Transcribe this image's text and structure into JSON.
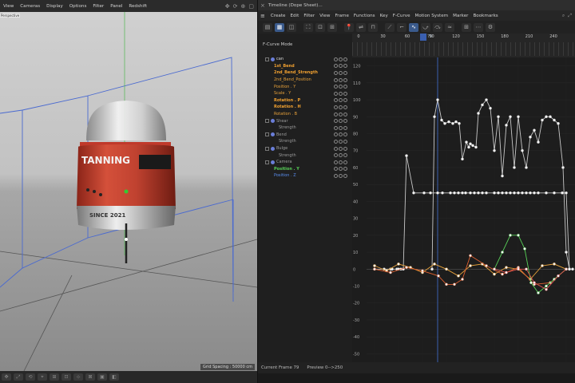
{
  "viewport": {
    "menu": [
      "View",
      "Cameras",
      "Display",
      "Options",
      "Filter",
      "Panel",
      "Redshift"
    ],
    "label": "Perspective",
    "grid_spacing": "Grid Spacing : 50000 cm",
    "can_text": {
      "brand": "TANNING",
      "sub": "SINCE 2021"
    }
  },
  "timeline": {
    "title": "Timeline (Dope Sheet)...",
    "menu": [
      "Create",
      "Edit",
      "Filter",
      "View",
      "Frame",
      "Functions",
      "Key",
      "F-Curve",
      "Motion System",
      "Marker",
      "Bookmarks"
    ],
    "mode_label": "F-Curve Mode",
    "ruler": {
      "ticks": [
        "0",
        "30",
        "60",
        "90",
        "120",
        "150",
        "180",
        "210",
        "240"
      ],
      "current": "79"
    },
    "tracks": [
      {
        "label": "can",
        "color": "white",
        "type": "object"
      },
      {
        "label": "1st_Bend",
        "color": "orange-bold"
      },
      {
        "label": "2nd_Bend_Strength",
        "color": "orange-bold"
      },
      {
        "label": "2nd_Bend_Position",
        "color": "orange"
      },
      {
        "label": "Position . Y",
        "color": "orange"
      },
      {
        "label": "Scale . Y",
        "color": "orange"
      },
      {
        "label": "Rotation . P",
        "color": "orange-bold"
      },
      {
        "label": "Rotation . H",
        "color": "orange-bold"
      },
      {
        "label": "Rotation . B",
        "color": "orange"
      },
      {
        "label": "Shear",
        "color": "gray",
        "type": "object"
      },
      {
        "label": "Strength",
        "color": "gray"
      },
      {
        "label": "Bend",
        "color": "gray",
        "type": "object"
      },
      {
        "label": "Strength",
        "color": "gray"
      },
      {
        "label": "Bulge",
        "color": "gray",
        "type": "object"
      },
      {
        "label": "Strength",
        "color": "gray"
      },
      {
        "label": "Camera",
        "color": "gray",
        "type": "camera"
      },
      {
        "label": "Position . Y",
        "color": "green"
      },
      {
        "label": "Position . Z",
        "color": "blue"
      }
    ],
    "y_axis": [
      "120",
      "110",
      "100",
      "90",
      "80",
      "70",
      "60",
      "50",
      "40",
      "30",
      "20",
      "10",
      "0",
      "-10",
      "-20",
      "-30",
      "-40",
      "-50"
    ],
    "status": {
      "current_frame": "Current Frame  79",
      "preview": "Preview  0-->250"
    }
  },
  "chart_data": {
    "type": "line",
    "xlabel": "",
    "ylabel": "",
    "xlim": [
      -10,
      250
    ],
    "ylim": [
      -55,
      125
    ],
    "series": [
      {
        "color": "#c8c8c8",
        "x": [
          0,
          12,
          20,
          22,
          28,
          30,
          33,
          36,
          40,
          49,
          62,
          70,
          79,
          85,
          95,
          100,
          105,
          110,
          114,
          120,
          125,
          130,
          135,
          140,
          150,
          155,
          160,
          165,
          170,
          175,
          180,
          185,
          190,
          195,
          200,
          205,
          215,
          225,
          235,
          240,
          244,
          248
        ],
        "y": [
          0,
          0,
          0,
          0,
          0,
          0,
          0,
          0,
          67,
          45,
          45,
          45,
          45,
          45,
          45,
          45,
          45,
          45,
          45,
          45,
          45,
          45,
          45,
          45,
          45,
          45,
          45,
          45,
          45,
          45,
          45,
          45,
          45,
          45,
          45,
          45,
          45,
          45,
          45,
          45,
          0,
          0
        ]
      },
      {
        "color": "#c8c8c8",
        "x": [
          72,
          75,
          79,
          84,
          88,
          93,
          98,
          102,
          106,
          110,
          115,
          118,
          120,
          123,
          127,
          130,
          135,
          140,
          145,
          150,
          155,
          160,
          165,
          170,
          175,
          180,
          185,
          190,
          195,
          200,
          205,
          210,
          215,
          220,
          225,
          230,
          236,
          240,
          244
        ],
        "y": [
          0,
          90,
          100,
          88,
          86,
          87,
          86,
          87,
          86,
          65,
          75,
          72,
          74,
          73,
          72,
          92,
          97,
          100,
          95,
          70,
          90,
          55,
          85,
          90,
          60,
          90,
          70,
          60,
          78,
          82,
          75,
          88,
          90,
          90,
          88,
          86,
          60,
          10,
          0
        ]
      },
      {
        "color": "#e8a23a",
        "x": [
          0,
          15,
          30,
          45,
          60,
          75,
          90,
          105,
          120,
          135,
          150,
          165,
          180,
          195,
          210,
          225,
          240
        ],
        "y": [
          2,
          -1,
          3,
          1,
          -2,
          3,
          0,
          -4,
          2,
          3,
          -3,
          1,
          0,
          -6,
          2,
          3,
          0
        ]
      },
      {
        "color": "#e06030",
        "x": [
          0,
          20,
          40,
          60,
          80,
          90,
          100,
          110,
          120,
          140,
          160,
          180,
          200,
          220,
          240
        ],
        "y": [
          0,
          -2,
          1,
          -1,
          -4,
          -9,
          -9,
          -6,
          8,
          2,
          -3,
          1,
          -9,
          -8,
          0
        ]
      },
      {
        "color": "#58d058",
        "x": [
          150,
          160,
          170,
          180,
          188,
          196,
          205,
          215,
          225,
          240
        ],
        "y": [
          0,
          10,
          20,
          20,
          12,
          -8,
          -14,
          -10,
          -6,
          0
        ]
      },
      {
        "color": "#e05050",
        "x": [
          150,
          165,
          180,
          190,
          200,
          215,
          230,
          240
        ],
        "y": [
          0,
          -2,
          0,
          0,
          -8,
          -12,
          -4,
          0
        ]
      }
    ]
  }
}
